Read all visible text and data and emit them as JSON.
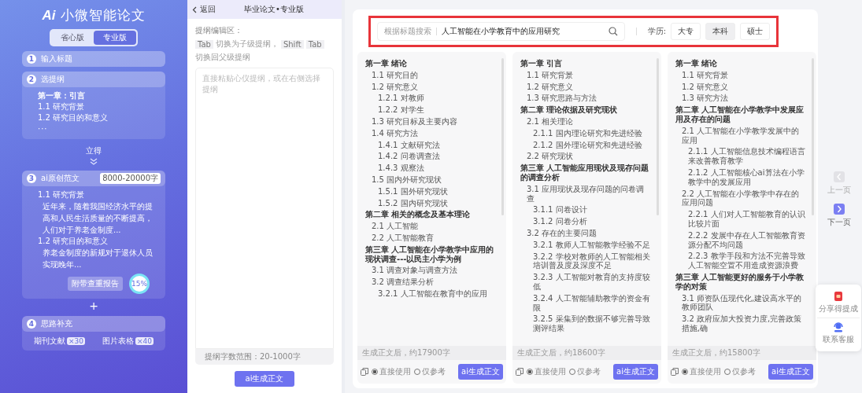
{
  "sidebar": {
    "logo_mark": "Ai",
    "title": "小微智能论文",
    "versions": [
      {
        "label": "省心版",
        "selected": false
      },
      {
        "label": "专业版",
        "selected": true
      }
    ],
    "steps": [
      {
        "number": "1",
        "title": "输入标题"
      },
      {
        "number": "2",
        "title": "选提纲",
        "lines": [
          {
            "kind": "chapter",
            "text": "第一章：引言"
          },
          {
            "kind": "section",
            "text": "1.1 研究背景"
          },
          {
            "kind": "section",
            "text": "1.2 研究目的和意义"
          },
          {
            "kind": "more",
            "text": "···"
          }
        ]
      },
      {
        "number": "3",
        "title": "ai原创范文",
        "badge": "8000-20000字",
        "lines": [
          {
            "kind": "section",
            "text": "1.1 研究背景"
          },
          {
            "kind": "paragraph",
            "text": "近年来，随着我国经济水平的提高和人民生活质量的不断提高，人们对于养老金制度..."
          },
          {
            "kind": "section",
            "text": "1.2 研究目的和意义"
          },
          {
            "kind": "paragraph",
            "text": "养老金制度的新规对于退休人员实现晚年..."
          }
        ],
        "report_label": "附带查重报告",
        "report_value": "15%"
      },
      {
        "number": "4",
        "title": "思路补充",
        "tags": [
          {
            "label": "期刊文献",
            "count": "×30"
          },
          {
            "label": "图片表格",
            "count": "×40"
          }
        ]
      }
    ],
    "connector": "立得",
    "plus": "+"
  },
  "editor": {
    "back": "返回",
    "title": "毕业论文•专业版",
    "label": "提纲编辑区：",
    "hint": [
      {
        "kind": "key",
        "text": "Tab"
      },
      {
        "kind": "text",
        "text": "切换为子级提纲，"
      },
      {
        "kind": "key",
        "text": "Shift"
      },
      {
        "kind": "key",
        "text": "Tab"
      },
      {
        "kind": "text",
        "text": "切换回父级提纲"
      }
    ],
    "placeholder": "直接粘贴心仪提纲，或在右侧选择提纲",
    "limit": "提纲字数范围：20-1000字",
    "button": "ai生成正文"
  },
  "search": {
    "highlighted": true,
    "label": "根据标题搜索",
    "value": "人工智能在小学教育中的应用研究",
    "degree_label": "学历:",
    "degrees": [
      {
        "label": "大专",
        "selected": false
      },
      {
        "label": "本科",
        "selected": true
      },
      {
        "label": "硕士",
        "selected": false
      }
    ]
  },
  "outlines": [
    {
      "items": [
        {
          "text": "第一章 绪论",
          "children": [
            {
              "text": "1.1 研究目的"
            },
            {
              "text": "1.2 研究意义",
              "children": [
                {
                  "text": "1.2.1 对教师"
                },
                {
                  "text": "1.2.2 对学生"
                }
              ]
            },
            {
              "text": "1.3 研究目标及主要内容"
            },
            {
              "text": "1.4 研究方法",
              "children": [
                {
                  "text": "1.4.1 文献研究法"
                },
                {
                  "text": "1.4.2 问卷调查法"
                },
                {
                  "text": "1.4.3 观察法"
                }
              ]
            },
            {
              "text": "1.5 国内外研究现状",
              "children": [
                {
                  "text": "1.5.1 国外研究现状"
                },
                {
                  "text": "1.5.2 国内研究现状"
                }
              ]
            }
          ]
        },
        {
          "text": "第二章 相关的概念及基本理论",
          "children": [
            {
              "text": "2.1 人工智能"
            },
            {
              "text": "2.2 人工智能教育"
            }
          ]
        },
        {
          "text": "第三章 人工智能在小学教学中应用的现状调查---以民主小学为例",
          "children": [
            {
              "text": "3.1 调查对象与调查方法"
            },
            {
              "text": "3.2 调查结果分析",
              "children": [
                {
                  "text": "3.2.1 人工智能在教育中的应用"
                }
              ]
            }
          ]
        }
      ],
      "word_count": "生成正文后，约17900字",
      "modes": [
        {
          "label": "直接使用",
          "selected": true
        },
        {
          "label": "仅参考",
          "selected": false
        }
      ],
      "button": "ai生成正文"
    },
    {
      "items": [
        {
          "text": "第一章 引言",
          "children": [
            {
              "text": "1.1 研究背景"
            },
            {
              "text": "1.2 研究意义"
            },
            {
              "text": "1.3 研究思路与方法"
            }
          ]
        },
        {
          "text": "第二章 理论依据及研究现状",
          "children": [
            {
              "text": "2.1 相关理论",
              "children": [
                {
                  "text": "2.1.1 国内理论研究和先进经验"
                },
                {
                  "text": "2.1.2 国外理论研究和先进经验"
                }
              ]
            },
            {
              "text": "2.2 研究现状"
            }
          ]
        },
        {
          "text": "第三章 人工智能应用现状及现存问题的调查分析",
          "children": [
            {
              "text": "3.1 应用现状及现存问题的问卷调查",
              "children": [
                {
                  "text": "3.1.1 问卷设计"
                },
                {
                  "text": "3.1.2 问卷分析"
                }
              ]
            },
            {
              "text": "3.2 存在的主要问题",
              "children": [
                {
                  "text": "3.2.1 教师人工智能教学经验不足"
                },
                {
                  "text": "3.2.2 学校对教师的人工智能相关培训普及度及深度不足"
                },
                {
                  "text": "3.2.3 人工智能对教育的支持度较低"
                },
                {
                  "text": "3.2.4 人工智能辅助教学的资金有限"
                },
                {
                  "text": "3.2.5 采集到的数据不够完善导致测评结果"
                }
              ]
            }
          ]
        }
      ],
      "word_count": "生成正文后，约18600字",
      "modes": [
        {
          "label": "直接使用",
          "selected": true
        },
        {
          "label": "仅参考",
          "selected": false
        }
      ],
      "button": "ai生成正文"
    },
    {
      "items": [
        {
          "text": "第一章 绪论",
          "children": [
            {
              "text": "1.1 研究背景"
            },
            {
              "text": "1.2 研究意义"
            },
            {
              "text": "1.3 研究方法"
            }
          ]
        },
        {
          "text": "第二章 人工智能在小学教学中发展应用及存在的问题",
          "children": [
            {
              "text": "2.1 人工智能在小学教学发展中的应用",
              "children": [
                {
                  "text": "2.1.1 人工智能信息技术编程语言来改善教育教学"
                },
                {
                  "text": "2.1.2 人工智能核心ai算法在小学教学中的发展应用"
                }
              ]
            },
            {
              "text": "2.2 人工智能在小学教学中存在的应用问题",
              "children": [
                {
                  "text": "2.2.1 人们对人工智能教育的认识比较片面"
                },
                {
                  "text": "2.2.2 发展中存在人工智能教育资源分配不均问题"
                },
                {
                  "text": "2.2.3 教学手段和方法不完善导致人工智能空置不用造成资源浪费"
                }
              ]
            }
          ]
        },
        {
          "text": "第三章 人工智能更好的服务于小学教学的对策",
          "children": [
            {
              "text": "3.1 师资队伍现代化,建设高水平的教师团队"
            },
            {
              "text": "3.2 政府应加大投资力度,完善政策措施,确"
            }
          ]
        }
      ],
      "word_count": "生成正文后，约15800字",
      "modes": [
        {
          "label": "直接使用",
          "selected": true
        },
        {
          "label": "仅参考",
          "selected": false
        }
      ],
      "button": "ai生成正文"
    }
  ],
  "pager": [
    {
      "label": "上一页",
      "kind": "prev",
      "disabled": true
    },
    {
      "label": "下一页",
      "kind": "next",
      "disabled": false
    }
  ],
  "float_menu": [
    {
      "kind": "share",
      "label": "分享得提成"
    },
    {
      "kind": "service",
      "label": "联系客服"
    }
  ]
}
